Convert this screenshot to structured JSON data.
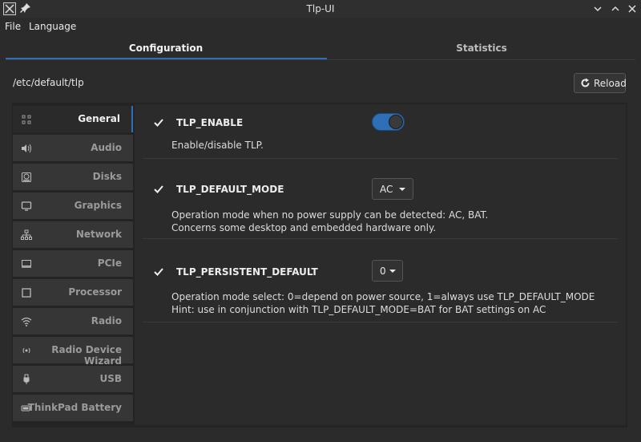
{
  "window": {
    "title": "Tlp-UI"
  },
  "menu": [
    "File",
    "Language"
  ],
  "tabs": [
    {
      "label": "Configuration",
      "active": true
    },
    {
      "label": "Statistics",
      "active": false
    }
  ],
  "config_path": "/etc/default/tlp",
  "reload_label": "Reload",
  "sidebar": {
    "items": [
      {
        "label": "General",
        "icon": "grid-icon",
        "active": true
      },
      {
        "label": "Audio",
        "icon": "speaker-icon"
      },
      {
        "label": "Disks",
        "icon": "disk-icon"
      },
      {
        "label": "Graphics",
        "icon": "monitor-icon"
      },
      {
        "label": "Network",
        "icon": "network-icon"
      },
      {
        "label": "PCIe",
        "icon": "card-icon"
      },
      {
        "label": "Processor",
        "icon": "cpu-icon"
      },
      {
        "label": "Radio",
        "icon": "wifi-icon"
      },
      {
        "label": "Radio Device Wizard",
        "icon": "antenna-icon"
      },
      {
        "label": "USB",
        "icon": "usb-icon"
      },
      {
        "label": "ThinkPad Battery",
        "icon": "battery-icon"
      }
    ]
  },
  "settings": [
    {
      "name": "TLP_ENABLE",
      "checked": true,
      "control": "toggle",
      "toggle_on": true,
      "desc": [
        "Enable/disable TLP."
      ]
    },
    {
      "name": "TLP_DEFAULT_MODE",
      "checked": true,
      "control": "combo",
      "value": "AC",
      "desc": [
        "Operation mode when no power supply can be detected: AC, BAT.",
        "Concerns some desktop and embedded hardware only."
      ]
    },
    {
      "name": "TLP_PERSISTENT_DEFAULT",
      "checked": true,
      "control": "combo",
      "value": "0",
      "desc": [
        "Operation mode select: 0=depend on power source, 1=always use TLP_DEFAULT_MODE",
        "Hint: use in conjunction with TLP_DEFAULT_MODE=BAT for BAT settings on AC"
      ]
    }
  ],
  "colors": {
    "accent": "#2f6fb8",
    "background": "#2b2b2b",
    "sidebar_item": "#363636"
  }
}
